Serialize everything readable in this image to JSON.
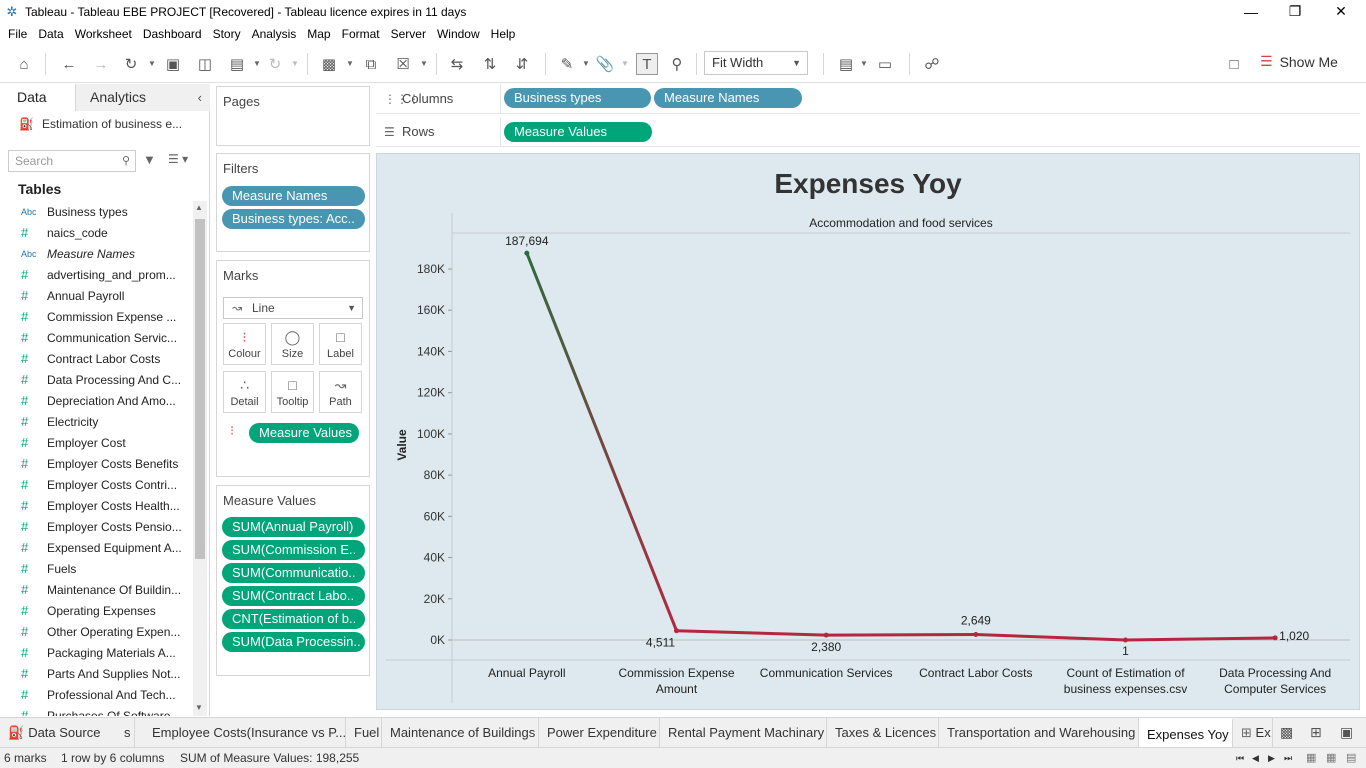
{
  "window": {
    "title": "Tableau - Tableau EBE PROJECT [Recovered] - Tableau licence expires in 11 days",
    "controls": [
      "minimize-icon",
      "restore-icon",
      "close-icon"
    ]
  },
  "menu": [
    "File",
    "Data",
    "Worksheet",
    "Dashboard",
    "Story",
    "Analysis",
    "Map",
    "Format",
    "Server",
    "Window",
    "Help"
  ],
  "toolbar": {
    "fit_label": "Fit Width",
    "show_me_label": "Show Me"
  },
  "data_pane": {
    "tab_data": "Data",
    "tab_analytics": "Analytics",
    "datasource": "Estimation of business e...",
    "search_placeholder": "Search",
    "tables_heading": "Tables",
    "fields": [
      {
        "type": "Abc",
        "name": "Business types"
      },
      {
        "type": "#",
        "name": "naics_code"
      },
      {
        "type": "Abc",
        "name": "Measure Names"
      },
      {
        "type": "#",
        "name": "advertising_and_prom..."
      },
      {
        "type": "#",
        "name": "Annual Payroll"
      },
      {
        "type": "#",
        "name": "Commission Expense ..."
      },
      {
        "type": "#",
        "name": "Communication Servic..."
      },
      {
        "type": "#",
        "name": "Contract Labor Costs"
      },
      {
        "type": "#",
        "name": "Data Processing And C..."
      },
      {
        "type": "#",
        "name": "Depreciation And Amo..."
      },
      {
        "type": "#",
        "name": "Electricity"
      },
      {
        "type": "#",
        "name": "Employer Cost"
      },
      {
        "type": "#",
        "name": "Employer Costs Benefits"
      },
      {
        "type": "#",
        "name": "Employer Costs Contri..."
      },
      {
        "type": "#",
        "name": "Employer Costs Health..."
      },
      {
        "type": "#",
        "name": "Employer Costs Pensio..."
      },
      {
        "type": "#",
        "name": "Expensed Equipment A..."
      },
      {
        "type": "#",
        "name": "Fuels"
      },
      {
        "type": "#",
        "name": "Maintenance Of Buildin..."
      },
      {
        "type": "#",
        "name": "Operating Expenses"
      },
      {
        "type": "#",
        "name": "Other Operating Expen..."
      },
      {
        "type": "#",
        "name": "Packaging Materials A..."
      },
      {
        "type": "#",
        "name": "Parts And Supplies Not..."
      },
      {
        "type": "#",
        "name": "Professional And Tech..."
      },
      {
        "type": "#",
        "name": "Purchases Of Software..."
      }
    ]
  },
  "pages_card": {
    "title": "Pages"
  },
  "filters_card": {
    "title": "Filters",
    "pills": [
      "Measure Names",
      "Business types: Acc.."
    ]
  },
  "marks_card": {
    "title": "Marks",
    "mark_type": "Line",
    "buttons": [
      "Colour",
      "Size",
      "Label",
      "Detail",
      "Tooltip",
      "Path"
    ],
    "color_pill": "Measure Values"
  },
  "measure_values_card": {
    "title": "Measure Values",
    "pills": [
      "SUM(Annual Payroll)",
      "SUM(Commission E..",
      "SUM(Communicatio..",
      "SUM(Contract Labo..",
      "CNT(Estimation of b..",
      "SUM(Data Processin.."
    ]
  },
  "shelves": {
    "columns_label": "Columns",
    "columns_pills": [
      "Business types",
      "Measure Names"
    ],
    "rows_label": "Rows",
    "rows_pills": [
      "Measure Values"
    ]
  },
  "chart_data": {
    "type": "line",
    "title": "Expenses Yoy",
    "panel_header": "Accommodation and food services",
    "ylabel": "Value",
    "xlabel": "",
    "categories": [
      "Annual Payroll",
      "Commission Expense Amount",
      "Communication Services",
      "Contract Labor Costs",
      "Count of Estimation of business expenses.csv",
      "Data Processing And Computer Services"
    ],
    "values": [
      187694,
      4511,
      2380,
      2649,
      1,
      1020
    ],
    "data_labels": [
      "187,694",
      "4,511",
      "2,380",
      "2,649",
      "1",
      "1,020"
    ],
    "ylim": [
      0,
      190000
    ],
    "yticks": [
      0,
      20000,
      40000,
      60000,
      80000,
      100000,
      120000,
      140000,
      160000,
      180000
    ],
    "ytick_labels": [
      "0K",
      "20K",
      "40K",
      "60K",
      "80K",
      "100K",
      "120K",
      "140K",
      "160K",
      "180K"
    ],
    "colors": {
      "high": "#2e6b3c",
      "low": "#b5273f"
    }
  },
  "sheet_tabs": [
    "Data Source",
    "s",
    "Employee Costs(Insurance vs P...",
    "Fuel",
    "Maintenance of Buildings",
    "Power Expenditure",
    "Rental Payment Machinary",
    "Taxes & Licences",
    "Transportation and Warehousing",
    "Expenses Yoy",
    "Ex"
  ],
  "status": {
    "marks": "6 marks",
    "rows_cols": "1 row  by  6 columns",
    "sum": "SUM of Measure Values: 198,255"
  }
}
